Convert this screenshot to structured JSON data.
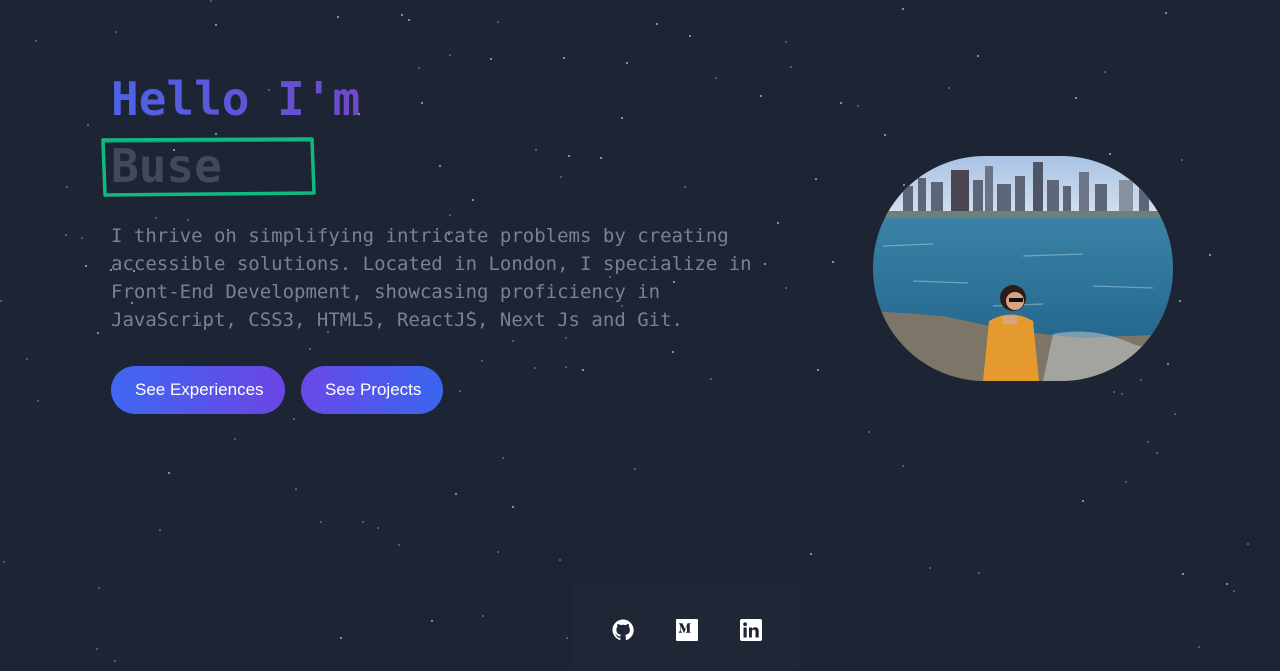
{
  "hero": {
    "greeting": "Hello I'm",
    "name": "Buse",
    "intro": "I thrive on simplifying intricate problems by creating accessible solutions. Located in London, I specialize in Front-End Development, showcasing proficiency in JavaScript, CSS3, HTML5, ReactJS, Next Js and Git."
  },
  "buttons": {
    "experiences": "See Experiences",
    "projects": "See Projects"
  },
  "profile_photo": {
    "icon": "profile-photo"
  },
  "social": [
    {
      "icon": "github-icon"
    },
    {
      "icon": "medium-icon"
    },
    {
      "icon": "linkedin-icon"
    }
  ],
  "colors": {
    "background": "#1d2433",
    "greeting_gradient_start": "#4c63e6",
    "greeting_gradient_end": "#6f49c9",
    "name_text": "#404a5c",
    "name_box_outline": "#10b981",
    "intro_text": "#7b8190",
    "button_gradient_start": "#3f67f2",
    "button_gradient_end": "#6b45e3"
  }
}
